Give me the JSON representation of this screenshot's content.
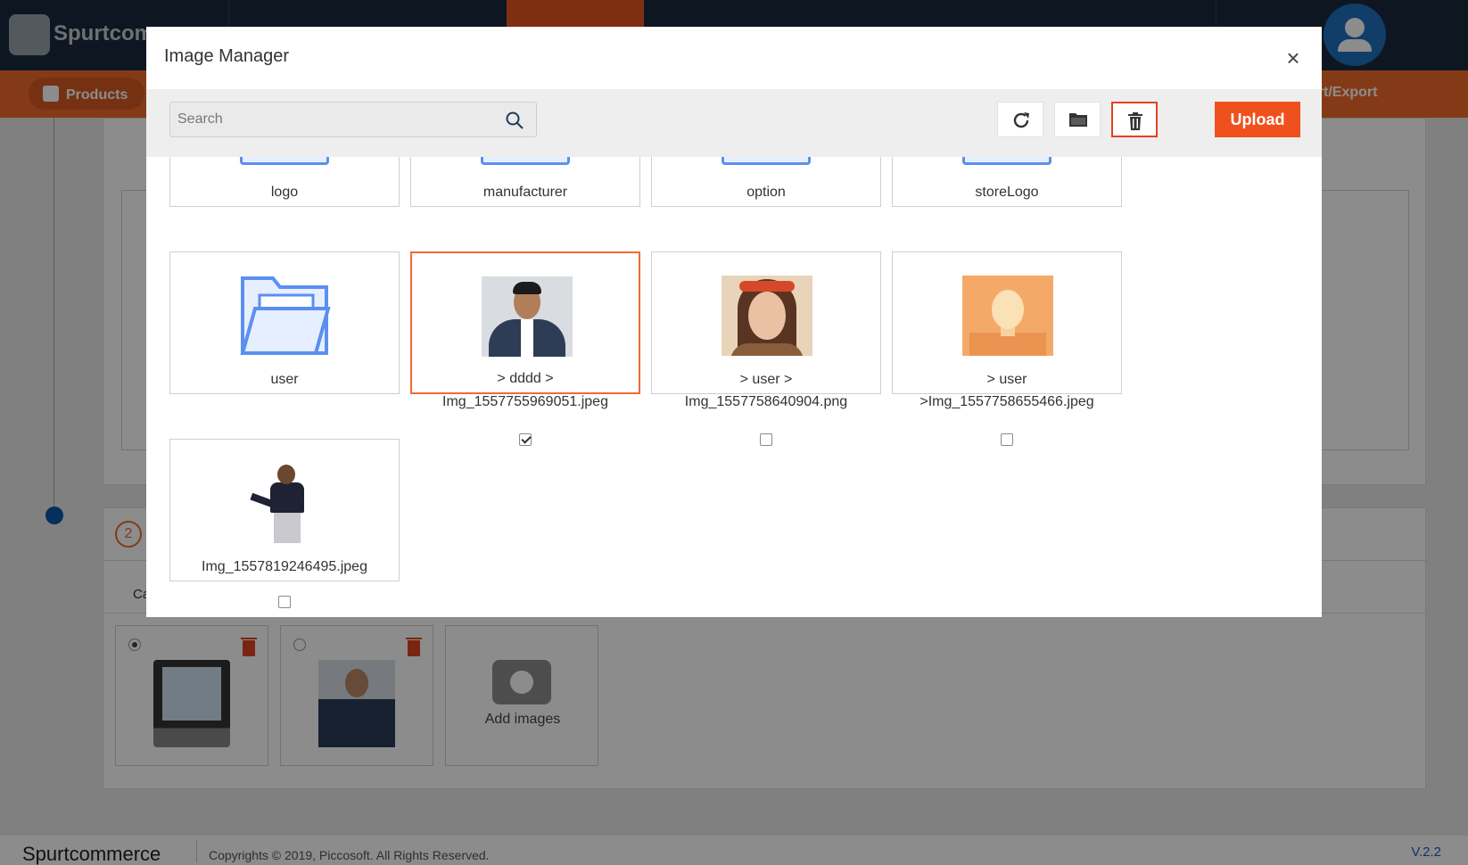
{
  "app": {
    "brand": "Spurtcom",
    "nav_active_label": "Products",
    "nav_right_label": "ort/Export"
  },
  "background": {
    "step_number": "2",
    "ca_label": "Ca",
    "add_images_label": "Add images"
  },
  "footer": {
    "brand": "Spurtcommerce",
    "copyright": "Copyrights © 2019, Piccosoft. All Rights Reserved.",
    "version": "V.2.2"
  },
  "modal": {
    "title": "Image Manager",
    "close_label": "×",
    "search": {
      "placeholder": "Search",
      "value": ""
    },
    "toolbar": {
      "refresh_icon": "refresh-icon",
      "folder_icon": "folder-icon",
      "delete_icon": "trash-icon",
      "upload_label": "Upload"
    },
    "folders_row1": [
      {
        "name": "logo"
      },
      {
        "name": "manufacturer"
      },
      {
        "name": "option"
      },
      {
        "name": "storeLogo"
      }
    ],
    "folder_user": {
      "name": "user"
    },
    "images": [
      {
        "line1": "> dddd >",
        "line2": "Img_1557755969051.jpeg",
        "checked": true
      },
      {
        "line1": "> user >",
        "line2": "Img_1557758640904.png",
        "checked": false
      },
      {
        "line1": "> user",
        "line2": ">Img_1557758655466.jpeg",
        "checked": false
      },
      {
        "line1": "Img_1557819246495.jpeg",
        "line2": "",
        "checked": false
      }
    ]
  },
  "colors": {
    "accent": "#f0501e",
    "topbar": "#1a2a3c",
    "folder": "#5b8ff0",
    "selected_border": "#ee6a3a"
  }
}
